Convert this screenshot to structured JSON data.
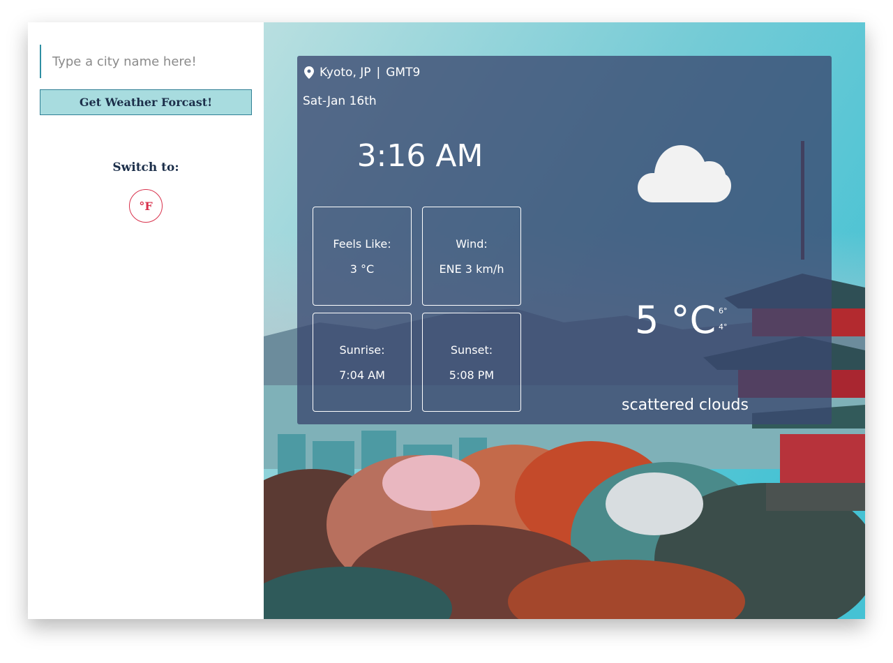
{
  "search": {
    "placeholder": "Type a city name here!",
    "button_label": "Get Weather Forcast!"
  },
  "units": {
    "switch_label": "Switch to:",
    "unit_button": "°F"
  },
  "weather": {
    "location": "Kyoto, JP",
    "separator": "|",
    "timezone": "GMT9",
    "date": "Sat-Jan 16th",
    "time": "3:16 AM",
    "feels_like_label": "Feels Like:",
    "feels_like_value": "3 °C",
    "wind_label": "Wind:",
    "wind_value": "ENE 3 km/h",
    "sunrise_label": "Sunrise:",
    "sunrise_value": "7:04 AM",
    "sunset_label": "Sunset:",
    "sunset_value": "5:08 PM",
    "temperature": "5 °C",
    "temp_max": "6°",
    "temp_min": "4°",
    "description": "scattered clouds",
    "icon": "cloud-icon"
  },
  "colors": {
    "accent": "#a8dcdf",
    "heading": "#1c2f4a",
    "unit_accent": "#d8304b",
    "card_bg": "#3a4870"
  }
}
